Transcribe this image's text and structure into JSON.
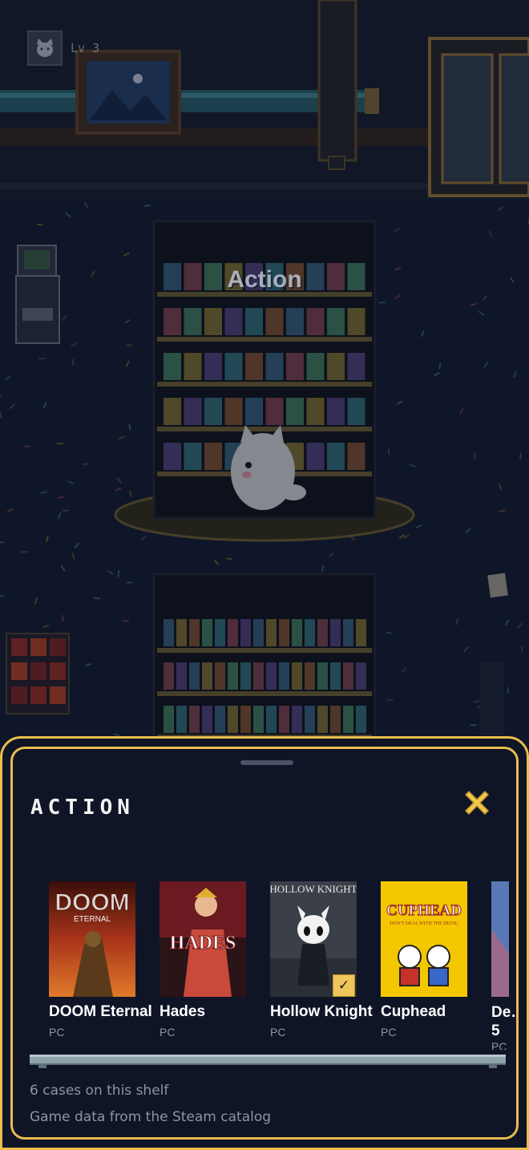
{
  "hud": {
    "level_label": "Lv 3",
    "avatar_icon": "cat-face-icon"
  },
  "scene": {
    "shelf_sign": "Action"
  },
  "panel": {
    "title": "ACTION",
    "close_icon": "close-x-icon",
    "accent_color": "#e8bd4d",
    "games": [
      {
        "title": "DOOM Eternal",
        "platform": "PC",
        "owned": false
      },
      {
        "title": "Hades",
        "platform": "PC",
        "owned": false
      },
      {
        "title": "Hollow Knight",
        "platform": "PC",
        "owned": true
      },
      {
        "title": "Cuphead",
        "platform": "PC",
        "owned": false
      },
      {
        "title": "De… 5",
        "platform": "PC",
        "owned": false
      }
    ],
    "cover_texts": {
      "doom_logo": "DOOM",
      "doom_sub": "ETERNAL",
      "hades_logo": "HADES",
      "hollow_logo": "HOLLOW KNIGHT",
      "cuphead_logo": "CUPHEAD",
      "cuphead_tag": "'DON'T DEAL WITH THE DEVIL'"
    },
    "footer": {
      "count": "6 cases on this shelf",
      "source": "Game data from the Steam catalog"
    }
  }
}
